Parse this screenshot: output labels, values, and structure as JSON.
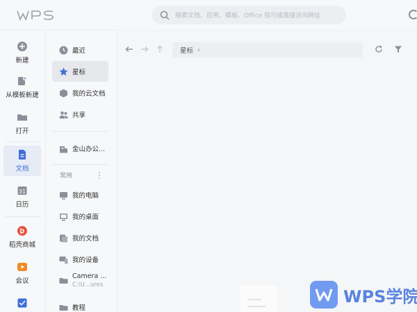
{
  "app": {
    "logo_text": "WPS",
    "search_placeholder": "搜索文档、应用、模板、Office 技巧或直接访问网址"
  },
  "rail": {
    "items": [
      {
        "label": "新建",
        "icon": "plus-circle-icon"
      },
      {
        "label": "从模板新建",
        "icon": "template-icon"
      },
      {
        "label": "打开",
        "icon": "folder-icon"
      },
      {
        "label": "文档",
        "icon": "document-icon",
        "active": true
      },
      {
        "label": "日历",
        "icon": "calendar-icon",
        "date": "31"
      },
      {
        "label": "稻壳商城",
        "icon": "docer-icon"
      },
      {
        "label": "会议",
        "icon": "meeting-icon"
      }
    ]
  },
  "nav": {
    "items": [
      {
        "label": "最近",
        "icon": "clock-icon"
      },
      {
        "label": "星标",
        "icon": "star-icon",
        "active": true
      },
      {
        "label": "我的云文档",
        "icon": "cloud-doc-icon"
      },
      {
        "label": "共享",
        "icon": "share-icon"
      },
      {
        "label": "金山办公...",
        "icon": "company-icon"
      }
    ],
    "section_label": "常用",
    "common": [
      {
        "label": "我的电脑",
        "icon": "computer-icon"
      },
      {
        "label": "我的桌面",
        "icon": "desktop-icon"
      },
      {
        "label": "我的文档",
        "icon": "documents-folder-icon"
      },
      {
        "label": "我的设备",
        "icon": "device-icon"
      },
      {
        "label": "Camera ...",
        "sub": "C:\\U...ures",
        "icon": "folder-icon"
      },
      {
        "label": "教程",
        "icon": "folder-icon"
      }
    ]
  },
  "main": {
    "breadcrumb": "星标"
  },
  "watermark": {
    "text": "WPS学院"
  },
  "colors": {
    "accent": "#3f6fd9",
    "active_bg": "#e6ebf5"
  }
}
